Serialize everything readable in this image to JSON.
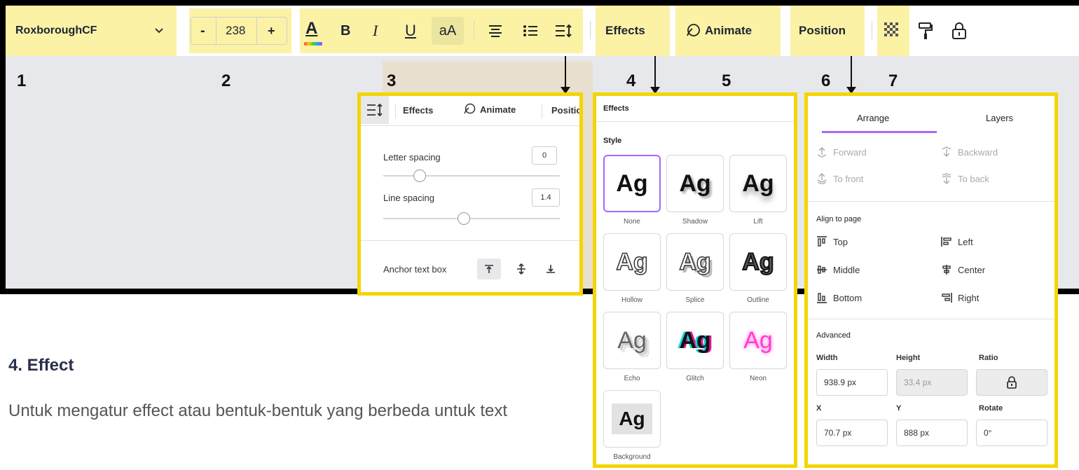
{
  "toolbar": {
    "font_name": "RoxboroughCF",
    "font_size": "238",
    "minus": "-",
    "plus": "+",
    "text_color_letter": "A",
    "bold": "B",
    "italic": "I",
    "underline": "U",
    "case": "aA",
    "effects": "Effects",
    "animate": "Animate",
    "position": "Position"
  },
  "numbers": [
    "1",
    "2",
    "3",
    "4",
    "5",
    "6",
    "7"
  ],
  "spacing_panel": {
    "tab_effects": "Effects",
    "tab_animate": "Animate",
    "tab_position": "Positic",
    "letter_spacing_label": "Letter spacing",
    "letter_spacing_value": "0",
    "line_spacing_label": "Line spacing",
    "line_spacing_value": "1.4",
    "anchor_label": "Anchor text box"
  },
  "effects_panel": {
    "title": "Effects",
    "style_label": "Style",
    "styles": [
      {
        "sample": "Ag",
        "name": "None"
      },
      {
        "sample": "Ag",
        "name": "Shadow"
      },
      {
        "sample": "Ag",
        "name": "Lift"
      },
      {
        "sample": "Ag",
        "name": "Hollow"
      },
      {
        "sample": "Ag",
        "name": "Splice"
      },
      {
        "sample": "Ag",
        "name": "Outline"
      },
      {
        "sample": "Ag",
        "name": "Echo"
      },
      {
        "sample": "Ag",
        "name": "Glitch"
      },
      {
        "sample": "Ag",
        "name": "Neon"
      },
      {
        "sample": "Ag",
        "name": "Background"
      }
    ]
  },
  "position_panel": {
    "tab_arrange": "Arrange",
    "tab_layers": "Layers",
    "forward": "Forward",
    "backward": "Backward",
    "to_front": "To front",
    "to_back": "To back",
    "align_label": "Align to page",
    "top": "Top",
    "left": "Left",
    "middle": "Middle",
    "center": "Center",
    "bottom": "Bottom",
    "right": "Right",
    "advanced_label": "Advanced",
    "width_label": "Width",
    "height_label": "Height",
    "ratio_label": "Ratio",
    "width_value": "938.9 px",
    "height_value": "33.4 px",
    "x_label": "X",
    "y_label": "Y",
    "rotate_label": "Rotate",
    "x_value": "70.7 px",
    "y_value": "888 px",
    "rotate_value": "0°"
  },
  "caption": {
    "heading": "4. Effect",
    "body": "Untuk mengatur effect atau bentuk-bentuk yang berbeda untuk text"
  },
  "colors": {
    "highlight": "#fbf2a6",
    "panel_border": "#f3d600",
    "accent": "#a56cf0",
    "heading": "#2a2f4a"
  }
}
